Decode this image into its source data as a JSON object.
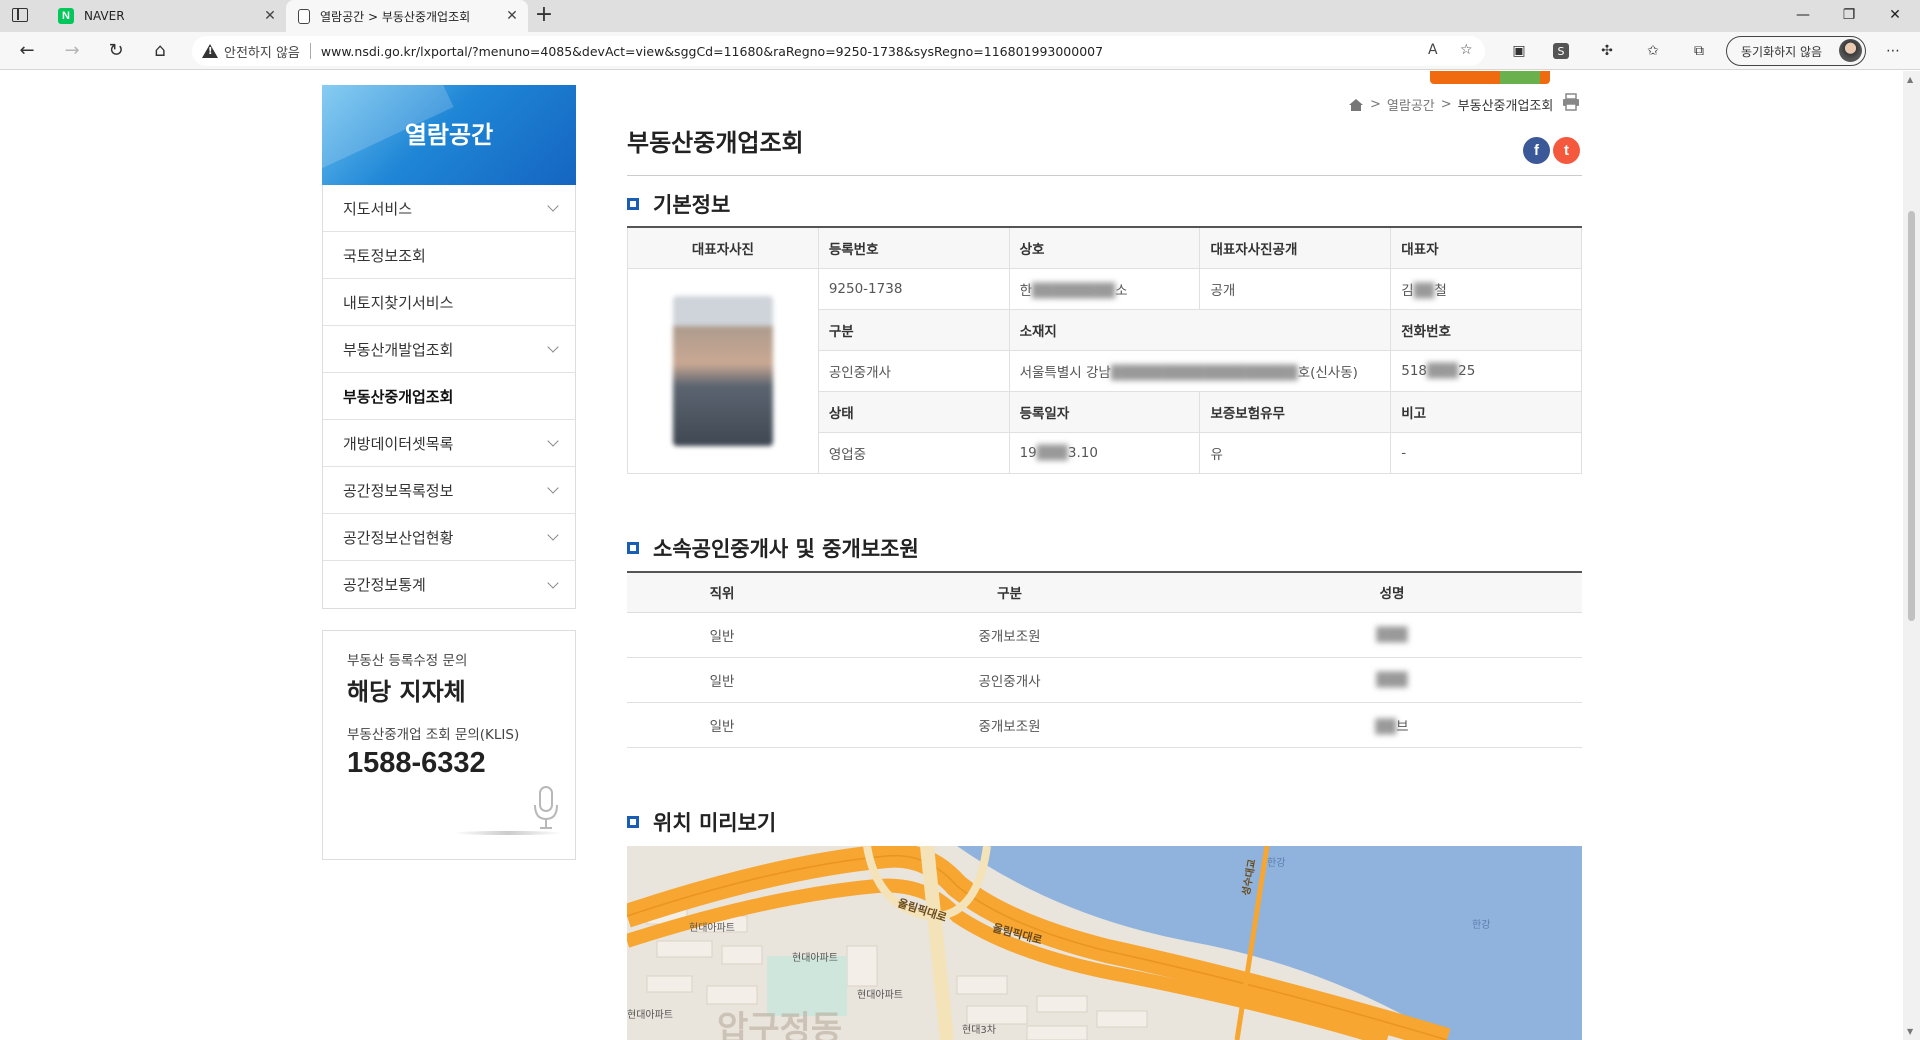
{
  "browser": {
    "tabs": [
      {
        "title": "NAVER",
        "favicon": "naver-icon",
        "active": false
      },
      {
        "title": "열람공간 > 부동산중개업조회",
        "favicon": "document-icon",
        "active": true
      }
    ],
    "not_secure_label": "안전하지 않음",
    "url": "www.nsdi.go.kr/lxportal/?menuno=4085&devAct=view&sggCd=11680&raRegno=9250-1738&sysRegno=116801993000007",
    "sync_label": "동기화하지 않음"
  },
  "sidebar": {
    "header": "열람공간",
    "items": [
      {
        "label": "지도서비스",
        "has_submenu": true
      },
      {
        "label": "국토정보조회",
        "has_submenu": false
      },
      {
        "label": "내토지찾기서비스",
        "has_submenu": false
      },
      {
        "label": "부동산개발업조회",
        "has_submenu": true
      },
      {
        "label": "부동산중개업조회",
        "has_submenu": false,
        "active": true
      },
      {
        "label": "개방데이터셋목록",
        "has_submenu": true
      },
      {
        "label": "공간정보목록정보",
        "has_submenu": true
      },
      {
        "label": "공간정보산업현황",
        "has_submenu": true
      },
      {
        "label": "공간정보통계",
        "has_submenu": true
      }
    ],
    "contact": {
      "label1": "부동산 등록수정 문의",
      "value1": "해당 지자체",
      "label2": "부동산중개업 조회 문의(KLIS)",
      "phone": "1588-6332"
    }
  },
  "breadcrumb": {
    "section": "열람공간",
    "current": "부동산중개업조회"
  },
  "page_title": "부동산중개업조회",
  "basic_info": {
    "title": "기본정보",
    "labels": {
      "photo": "대표자사진",
      "reg_no": "등록번호",
      "name": "상호",
      "photo_public": "대표자사진공개",
      "ceo": "대표자",
      "type": "구분",
      "address": "소재지",
      "phone": "전화번호",
      "status": "상태",
      "reg_date": "등록일자",
      "insurance": "보증보험유무",
      "note": "비고"
    },
    "values": {
      "reg_no": "9250-1738",
      "name_visible": "한",
      "name_masked": "████████",
      "name_suffix": "소",
      "photo_public": "공개",
      "ceo_first": "김",
      "ceo_masked": "██",
      "ceo_last": "철",
      "type": "공인중개사",
      "address_visible": "서울특별시 강남",
      "address_masked": "██████████████████",
      "address_suffix": "호(신사동)",
      "phone_prefix": "518",
      "phone_masked": "███",
      "phone_suffix": "25",
      "status": "영업중",
      "date_prefix": "19",
      "date_masked": "███",
      "date_suffix": "3.10",
      "insurance": "유",
      "note": "-"
    }
  },
  "staff": {
    "title": "소속공인중개사 및 중개보조원",
    "headers": [
      "직위",
      "구분",
      "성명"
    ],
    "rows": [
      {
        "position": "일반",
        "type": "중개보조원",
        "name_masked": "███"
      },
      {
        "position": "일반",
        "type": "공인중개사",
        "name_masked": "███"
      },
      {
        "position": "일반",
        "type": "중개보조원",
        "name_masked": "██",
        "name_suffix": "브"
      }
    ]
  },
  "map": {
    "title": "위치 미리보기",
    "labels": [
      "올림픽대로",
      "올림픽대로",
      "현대아파트",
      "현대아파트",
      "현대아파트",
      "현대아파트",
      "현대3차",
      "압구정동",
      "한강",
      "한강",
      "성수대교"
    ]
  },
  "colors": {
    "accent_blue": "#1a5db5",
    "facebook": "#3b5998",
    "twitter": "#f5593d",
    "road_orange": "#f7a631",
    "river": "#8fb3dc"
  }
}
